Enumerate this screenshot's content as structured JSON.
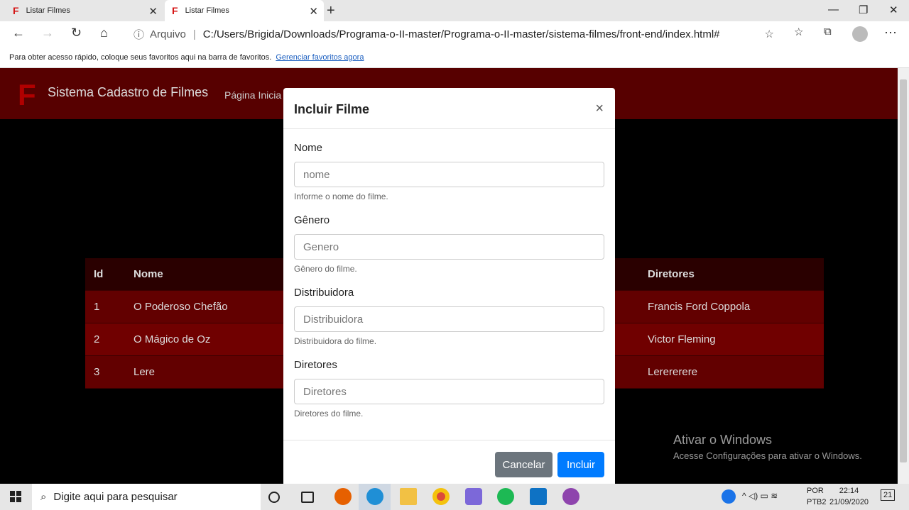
{
  "browser": {
    "tabs": [
      {
        "title": "Listar Filmes"
      },
      {
        "title": "Listar Filmes"
      }
    ],
    "address": {
      "label": "Arquivo",
      "url": "C:/Users/Brigida/Downloads/Programa-o-II-master/Programa-o-II-master/sistema-filmes/front-end/index.html#"
    },
    "favorites_text": "Para obter acesso rápido, coloque seus favoritos aqui na barra de favoritos.",
    "favorites_link": "Gerenciar favoritos agora"
  },
  "app": {
    "logo": "F",
    "brand": "Sistema Cadastro de Filmes",
    "nav": "Página Inicia"
  },
  "table": {
    "headers": [
      "Id",
      "Nome",
      "Diretores"
    ],
    "rows": [
      [
        "1",
        "O Poderoso Chefão",
        "Francis Ford Coppola"
      ],
      [
        "2",
        "O Mágico de Oz",
        "Victor Fleming"
      ],
      [
        "3",
        "Lere",
        "Lerererere"
      ]
    ]
  },
  "modal": {
    "title": "Incluir Filme",
    "close": "×",
    "fields": [
      {
        "label": "Nome",
        "placeholder": "nome",
        "help": "Informe o nome do filme."
      },
      {
        "label": "Gênero",
        "placeholder": "Genero",
        "help": "Gênero do filme."
      },
      {
        "label": "Distribuidora",
        "placeholder": "Distribuidora",
        "help": "Distribuidora do filme."
      },
      {
        "label": "Diretores",
        "placeholder": "Diretores",
        "help": "Diretores do filme."
      }
    ],
    "cancel": "Cancelar",
    "submit": "Incluir"
  },
  "activation": {
    "title": "Ativar o Windows",
    "subtitle": "Acesse Configurações para ativar o Windows."
  },
  "taskbar": {
    "search_placeholder": "Digite aqui para pesquisar",
    "lang1": "POR",
    "lang2": "PTB2",
    "time": "22:14",
    "date": "21/09/2020",
    "notifications": "21"
  }
}
